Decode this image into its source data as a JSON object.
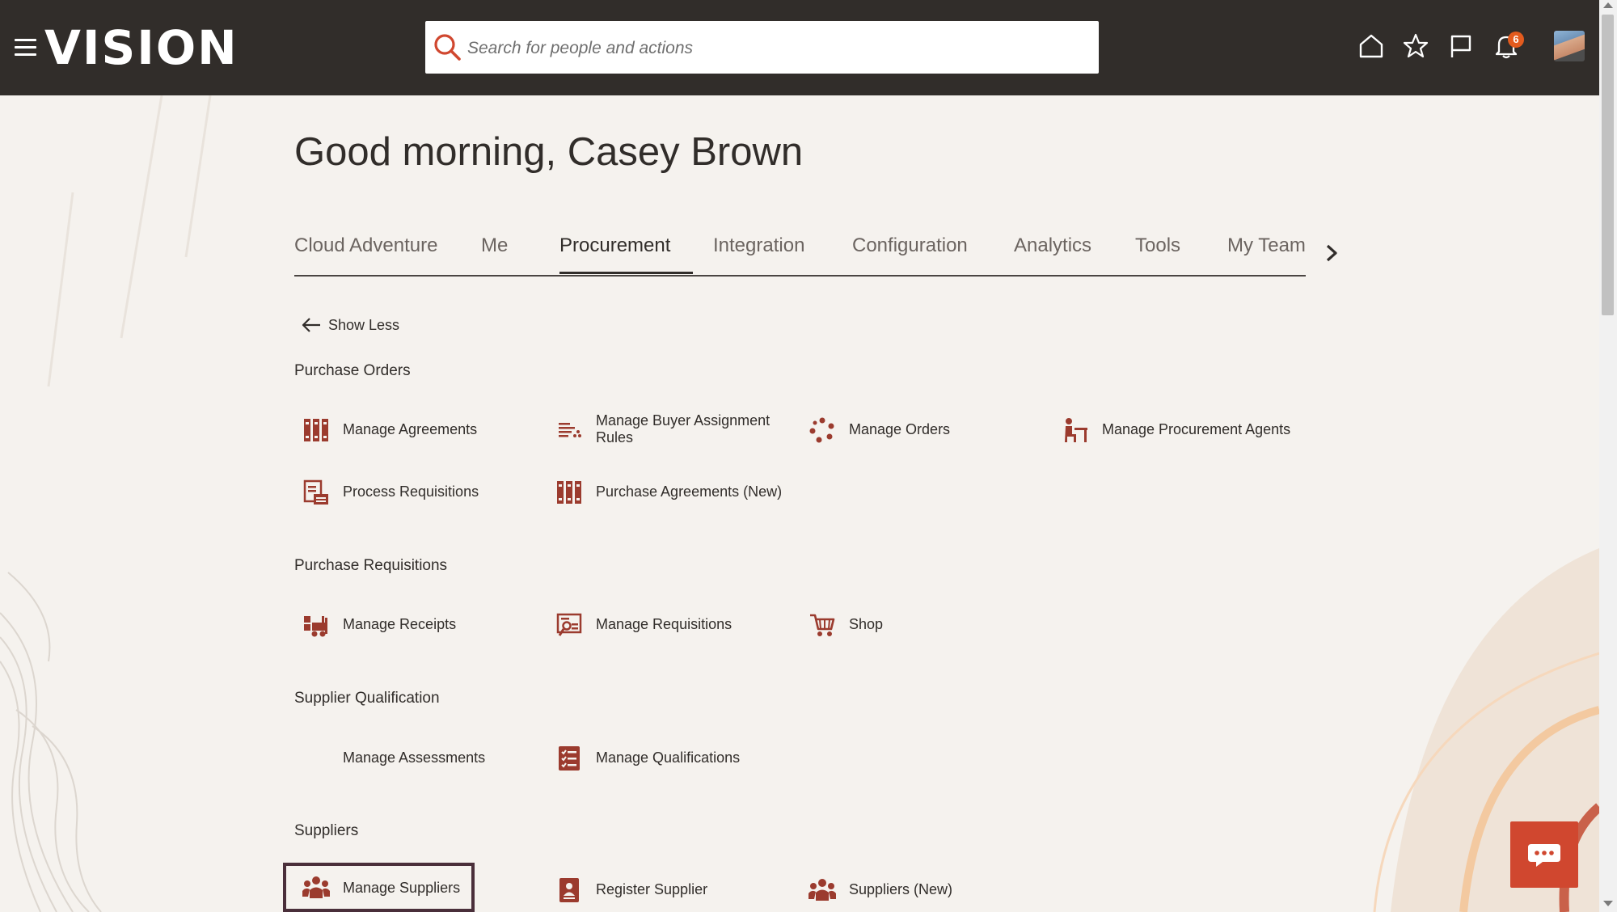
{
  "header": {
    "logo": "VISION",
    "search_placeholder": "Search for people and actions",
    "notification_count": "6",
    "icons": [
      "menu-icon",
      "search-icon",
      "home-icon",
      "star-icon",
      "flag-icon",
      "bell-icon",
      "avatar"
    ]
  },
  "greeting": "Good morning, Casey Brown",
  "tabs": [
    {
      "label": "Cloud Adventure"
    },
    {
      "label": "Me"
    },
    {
      "label": "Procurement",
      "active": true
    },
    {
      "label": "Integration"
    },
    {
      "label": "Configuration"
    },
    {
      "label": "Analytics"
    },
    {
      "label": "Tools"
    },
    {
      "label": "My Team"
    }
  ],
  "show_less": "Show Less",
  "sections": [
    {
      "title": "Purchase Orders",
      "items": [
        {
          "label": "Manage Agreements",
          "icon": "binders-icon"
        },
        {
          "label": "Manage Buyer Assignment Rules",
          "icon": "sort-list-icon"
        },
        {
          "label": "Manage Orders",
          "icon": "cycle-icon"
        },
        {
          "label": "Manage Procurement Agents",
          "icon": "agent-desk-icon"
        },
        {
          "label": "Process Requisitions",
          "icon": "requisition-process-icon"
        },
        {
          "label": "Purchase Agreements (New)",
          "icon": "binders-icon"
        }
      ]
    },
    {
      "title": "Purchase Requisitions",
      "items": [
        {
          "label": "Manage Receipts",
          "icon": "forklift-icon"
        },
        {
          "label": "Manage Requisitions",
          "icon": "requisition-search-icon"
        },
        {
          "label": "Shop",
          "icon": "cart-icon"
        }
      ]
    },
    {
      "title": "Supplier Qualification",
      "items": [
        {
          "label": "Manage Assessments",
          "icon": ""
        },
        {
          "label": "Manage Qualifications",
          "icon": "checklist-icon"
        }
      ]
    },
    {
      "title": "Suppliers",
      "items": [
        {
          "label": "Manage Suppliers",
          "icon": "group-icon",
          "selected": true
        },
        {
          "label": "Register Supplier",
          "icon": "badge-icon"
        },
        {
          "label": "Suppliers (New)",
          "icon": "group-icon"
        }
      ]
    }
  ],
  "colors": {
    "header_bg": "#312d2a",
    "page_bg": "#f5f2ee",
    "icon_accent": "#9b3b2e",
    "chat_button": "#d0472f",
    "badge": "#e35b1e",
    "selected_outline": "#4a2f3a"
  }
}
